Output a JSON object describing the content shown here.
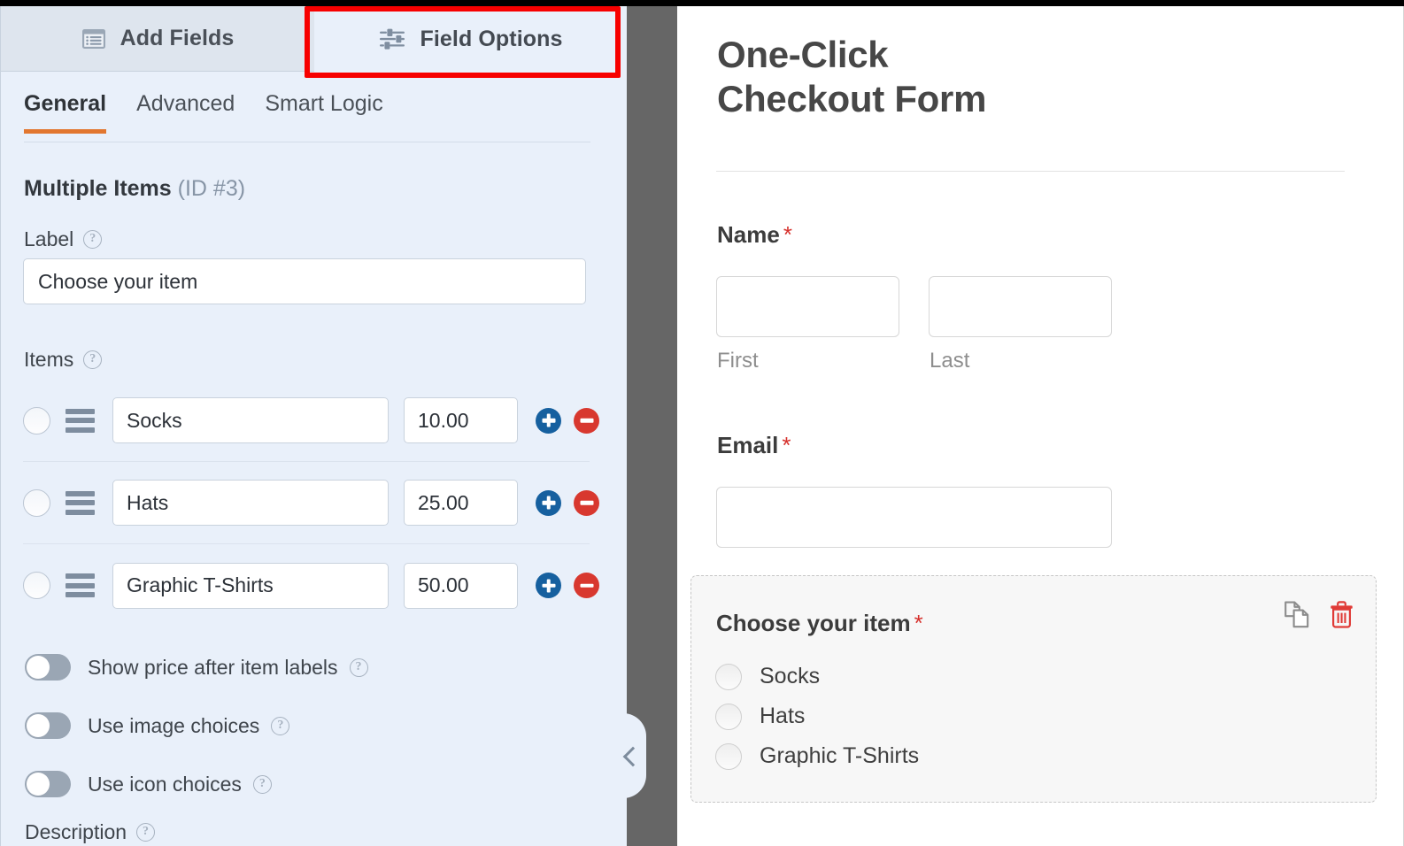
{
  "builder": {
    "main_tabs": [
      {
        "label": "Add Fields",
        "icon": "form-list-icon",
        "active": false
      },
      {
        "label": "Field Options",
        "icon": "sliders-icon",
        "active": true
      }
    ],
    "sub_tabs": [
      {
        "label": "General"
      },
      {
        "label": "Advanced"
      },
      {
        "label": "Smart Logic"
      }
    ],
    "field_heading": {
      "name": "Multiple Items",
      "id": "(ID #3)"
    },
    "label_section": {
      "title": "Label",
      "value": "Choose your item",
      "help_glyph": "?"
    },
    "items_section": {
      "title": "Items",
      "rows": [
        {
          "label": "Socks",
          "price": "10.00"
        },
        {
          "label": "Hats",
          "price": "25.00"
        },
        {
          "label": "Graphic T-Shirts",
          "price": "50.00"
        }
      ],
      "add_icon": "plus-circle-icon",
      "remove_icon": "minus-circle-icon"
    },
    "toggles": [
      {
        "label": "Show price after item labels",
        "on": false
      },
      {
        "label": "Use image choices",
        "on": false
      },
      {
        "label": "Use icon choices",
        "on": false
      }
    ],
    "description_label": "Description",
    "collapse_icon": "chevron-left-icon",
    "accent_color": "#e27730",
    "highlight_color": "#f70000"
  },
  "preview": {
    "form_title": "One-Click\nCheckout Form",
    "form_title_line1": "One-Click",
    "form_title_line2": "Checkout Form",
    "required_marker": "*",
    "fields": [
      {
        "label": "Name",
        "required": true,
        "sublabels": [
          "First",
          "Last"
        ]
      },
      {
        "label": "Email",
        "required": true
      }
    ],
    "active_field": {
      "label": "Choose your item",
      "required": true,
      "choices": [
        "Socks",
        "Hats",
        "Graphic T-Shirts"
      ],
      "actions": [
        {
          "name": "duplicate-field",
          "icon": "duplicate-icon",
          "color": "#8c8c8c"
        },
        {
          "name": "delete-field",
          "icon": "trash-icon",
          "color": "#e03b37"
        }
      ]
    }
  }
}
